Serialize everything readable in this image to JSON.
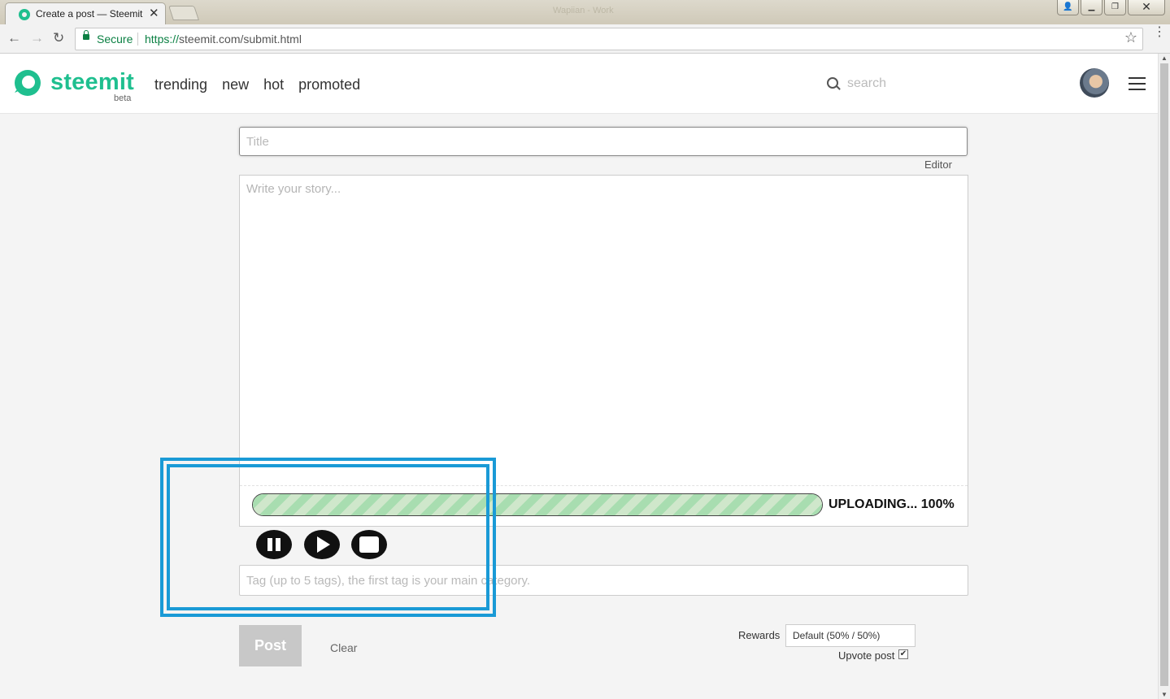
{
  "browser": {
    "tab_title": "Create a post — Steemit",
    "tab_close": "✕",
    "window_title": "Wapiian - Work",
    "secure_label": "Secure",
    "url_scheme": "https://",
    "url_rest": "steemit.com/submit.html",
    "back": "←",
    "forward": "→",
    "reload": "↻",
    "star": "☆",
    "menu": "⋮"
  },
  "header": {
    "logo_text": "steemit",
    "logo_beta": "beta",
    "nav": [
      "trending",
      "new",
      "hot",
      "promoted"
    ],
    "search_placeholder": "search"
  },
  "editor": {
    "title_placeholder": "Title",
    "editor_link": "Editor",
    "story_placeholder": "Write your story...",
    "tag_placeholder": "Tag (up to 5 tags), the first tag is your main category."
  },
  "upload": {
    "label": "UPLOADING... 100%",
    "progress_percent": 100
  },
  "footer": {
    "post_label": "Post",
    "clear_label": "Clear",
    "rewards_label": "Rewards",
    "rewards_value": "Default (50% / 50%)",
    "upvote_label": "Upvote post",
    "upvote_checked": true
  },
  "colors": {
    "brand": "#1fbf8f",
    "highlight": "#1a9ad6",
    "progress": "#a8ddb0"
  }
}
